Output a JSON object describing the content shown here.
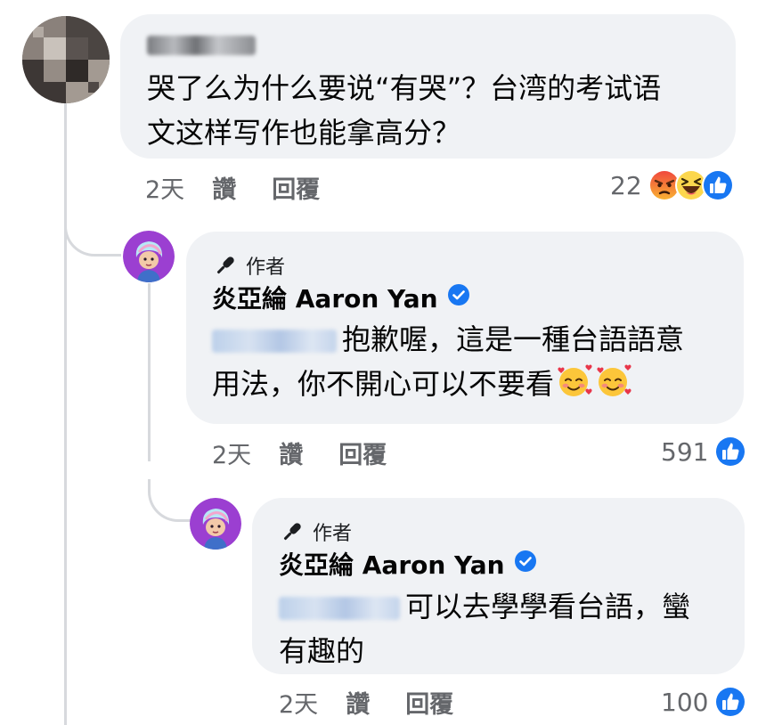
{
  "comments": [
    {
      "name": "Yi Zhao",
      "text_line1": "哭了么为什么要说“有哭”？台湾的考试语",
      "text_line2": "文这样写作也能拿高分？",
      "time": "2天",
      "like_label": "讚",
      "reply_label": "回覆",
      "reaction_count": "22",
      "reactions": [
        "angry",
        "haha",
        "like"
      ]
    },
    {
      "badge_label": "作者",
      "author_name": "炎亞綸 Aaron Yan",
      "verified": true,
      "mention": "Yi Zhao",
      "text_line1": "抱歉喔，這是一種台語語意",
      "text_line2": "用法，你不開心可以不要看",
      "trailing_emoji": [
        "smiling-face-with-hearts",
        "smiling-face-with-hearts"
      ],
      "time": "2天",
      "like_label": "讚",
      "reply_label": "回覆",
      "reaction_count": "591",
      "reactions": [
        "like"
      ]
    },
    {
      "badge_label": "作者",
      "author_name": "炎亞綸 Aaron Yan",
      "verified": true,
      "mention": "Yi Zhao",
      "text_line1": "可以去學學看台語，蠻",
      "text_line2": "有趣的",
      "time": "2天",
      "like_label": "讚",
      "reply_label": "回覆",
      "reaction_count": "100",
      "reactions": [
        "like"
      ]
    }
  ],
  "colors": {
    "bubble": "#f0f2f5",
    "thread": "#d7d9dd",
    "like_blue": "#1877f2",
    "meta_gray": "#65676b",
    "avatar_purple": "#9b3fd1"
  }
}
